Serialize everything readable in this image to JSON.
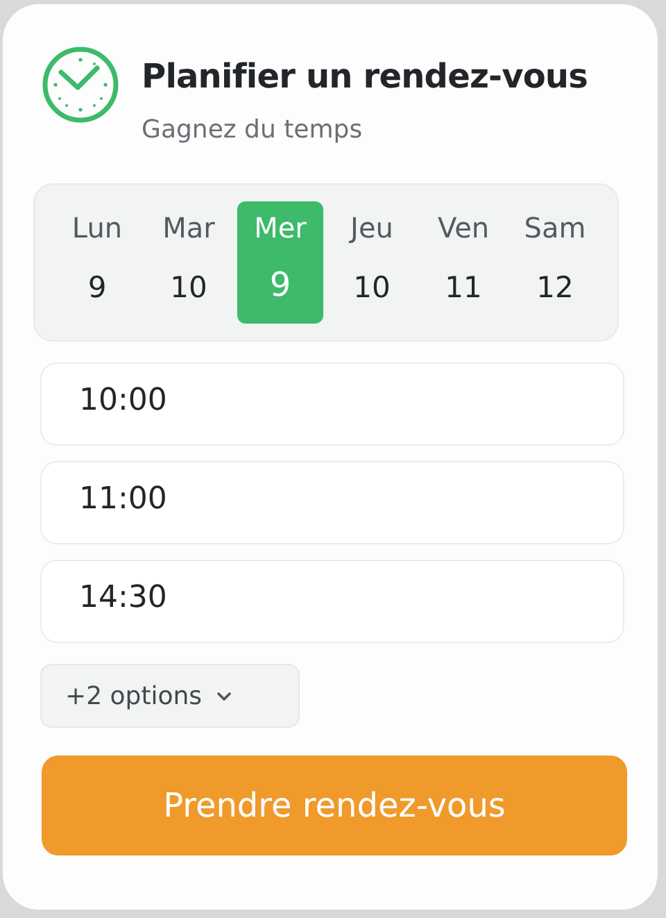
{
  "header": {
    "title": "Planifier un rendez-vous",
    "subtitle": "Gagnez du temps"
  },
  "days": [
    {
      "weekday": "Lun",
      "date": "9",
      "selected": false
    },
    {
      "weekday": "Mar",
      "date": "10",
      "selected": false
    },
    {
      "weekday": "Mer",
      "date": "9",
      "selected": true
    },
    {
      "weekday": "Jeu",
      "date": "10",
      "selected": false
    },
    {
      "weekday": "Ven",
      "date": "11",
      "selected": false
    },
    {
      "weekday": "Sam",
      "date": "12",
      "selected": false
    }
  ],
  "time_slots": [
    {
      "time": "10:00",
      "selected": false
    },
    {
      "time": "11:00",
      "selected": false
    },
    {
      "time": "14:30",
      "selected": false
    }
  ],
  "more_options": {
    "label": "+2 options"
  },
  "submit_button": "Prendre rendez-vous"
}
